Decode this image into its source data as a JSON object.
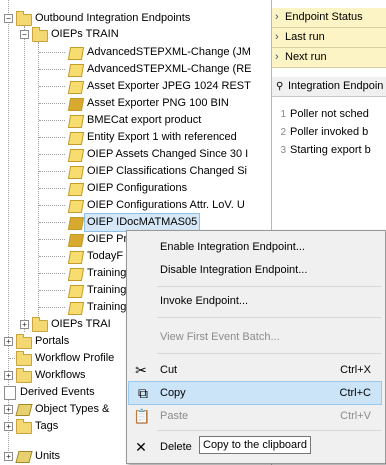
{
  "tree": {
    "outbound": "Outbound Integration Endpoints",
    "oieps_train": "OIEPs TRAIN",
    "items": [
      "AdvancedSTEPXML-Change (JM",
      "AdvancedSTEPXML-Change (RE",
      "Asset Exporter JPEG 1024 REST",
      "Asset Exporter PNG 100 BIN",
      "BMECat export product",
      "Entity Export 1 with referenced",
      "OIEP Assets Changed Since 30 I",
      "OIEP Classifications Changed Si",
      "OIEP Configurations",
      "OIEP Configurations Attr. LoV. U",
      "OIEP IDocMATMAS05",
      "OIEP Pr",
      "TodayF",
      "Training",
      "Training",
      "Training"
    ],
    "oieps_trai": "OIEPs TRAI",
    "portals": "Portals",
    "workflow_profiles": "Workflow Profile",
    "workflows": "Workflows",
    "derived_events": "Derived Events",
    "object_types": "Object Types &",
    "tags": "Tags",
    "units": "Units"
  },
  "right_panel": {
    "props": [
      "Endpoint Status",
      "Last run",
      "Next run"
    ],
    "section_title": "Integration Endpoin",
    "log": [
      {
        "n": "1",
        "text": "Poller not sched"
      },
      {
        "n": "2",
        "text": "Poller invoked b"
      },
      {
        "n": "3",
        "text": "Starting export b"
      }
    ]
  },
  "context_menu": {
    "enable": "Enable Integration Endpoint...",
    "disable": "Disable Integration Endpoint...",
    "invoke": "Invoke Endpoint...",
    "view_first": "View First Event Batch...",
    "cut": "Cut",
    "cut_key": "Ctrl+X",
    "copy": "Copy",
    "copy_key": "Ctrl+C",
    "paste": "Paste",
    "paste_key": "Ctrl+V",
    "delete": "Delete",
    "tooltip": "Copy to the clipboard"
  }
}
